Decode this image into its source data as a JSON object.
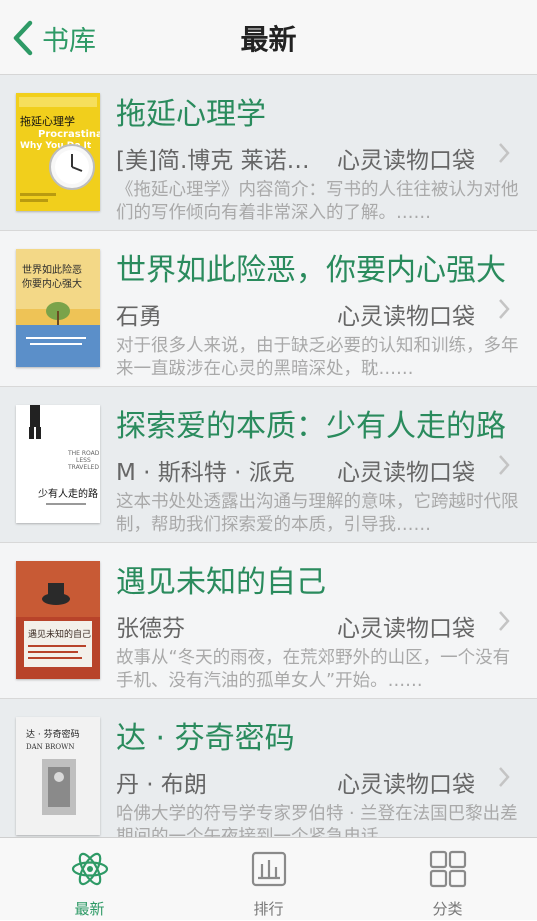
{
  "navbar": {
    "back_label": "书库",
    "title": "最新"
  },
  "books": [
    {
      "title": "拖延心理学",
      "author": "[美]简.博克 莱诺拉.袁",
      "publisher": "心灵读物口袋",
      "description": "《拖延心理学》内容简介：写书的人往往被认为对他们的写作倾向有着非常深入的了解。……",
      "cover": {
        "title": "拖延心理学",
        "subtitle": "Procrastination",
        "english": "Why You Do It",
        "bg": "#f1cf1c"
      }
    },
    {
      "title": "世界如此险恶，你要内心强大",
      "author": "石勇",
      "publisher": "心灵读物口袋",
      "description": "对于很多人来说，由于缺乏必要的认知和训练，多年来一直跋涉在心灵的黑暗深处，耽……",
      "cover": {
        "line1": "世界如此险恶",
        "line2": "你要内心强大",
        "bg": "#eec356"
      }
    },
    {
      "title": "探索爱的本质：少有人走的路",
      "author": "M · 斯科特 · 派克",
      "publisher": "心灵读物口袋",
      "description": "这本书处处透露出沟通与理解的意味，它跨越时代限制，帮助我们探索爱的本质，引导我……",
      "cover": {
        "en1": "THE ROAD",
        "en2": "LESS",
        "en3": "TRAVELED",
        "cn": "少有人走的路",
        "bg": "#ffffff"
      }
    },
    {
      "title": "遇见未知的自己",
      "author": "张德芬",
      "publisher": "心灵读物口袋",
      "description": "故事从“冬天的雨夜，在荒郊野外的山区，一个没有手机、没有汽油的孤单女人”开始。……",
      "cover": {
        "title": "遇见未知的自己",
        "bg": "#b8432a"
      }
    },
    {
      "title": "达 · 芬奇密码",
      "author": "丹 · 布朗",
      "publisher": "心灵读物口袋",
      "description": "哈佛大学的符号学专家罗伯特 · 兰登在法国巴黎出差期间的一个午夜接到一个紧急电话……",
      "cover": {
        "title": "达 · 芬奇密码",
        "author_en": "DAN BROWN",
        "bg": "#f2f2f2"
      }
    }
  ],
  "tabs": [
    {
      "label": "最新",
      "icon": "atom-icon"
    },
    {
      "label": "排行",
      "icon": "bar-chart-icon"
    },
    {
      "label": "分类",
      "icon": "grid-icon"
    }
  ],
  "colors": {
    "accent": "#2e9a66",
    "title_green": "#2a8b5d",
    "meta_gray": "#666666",
    "desc_gray": "#a9a9a9"
  }
}
